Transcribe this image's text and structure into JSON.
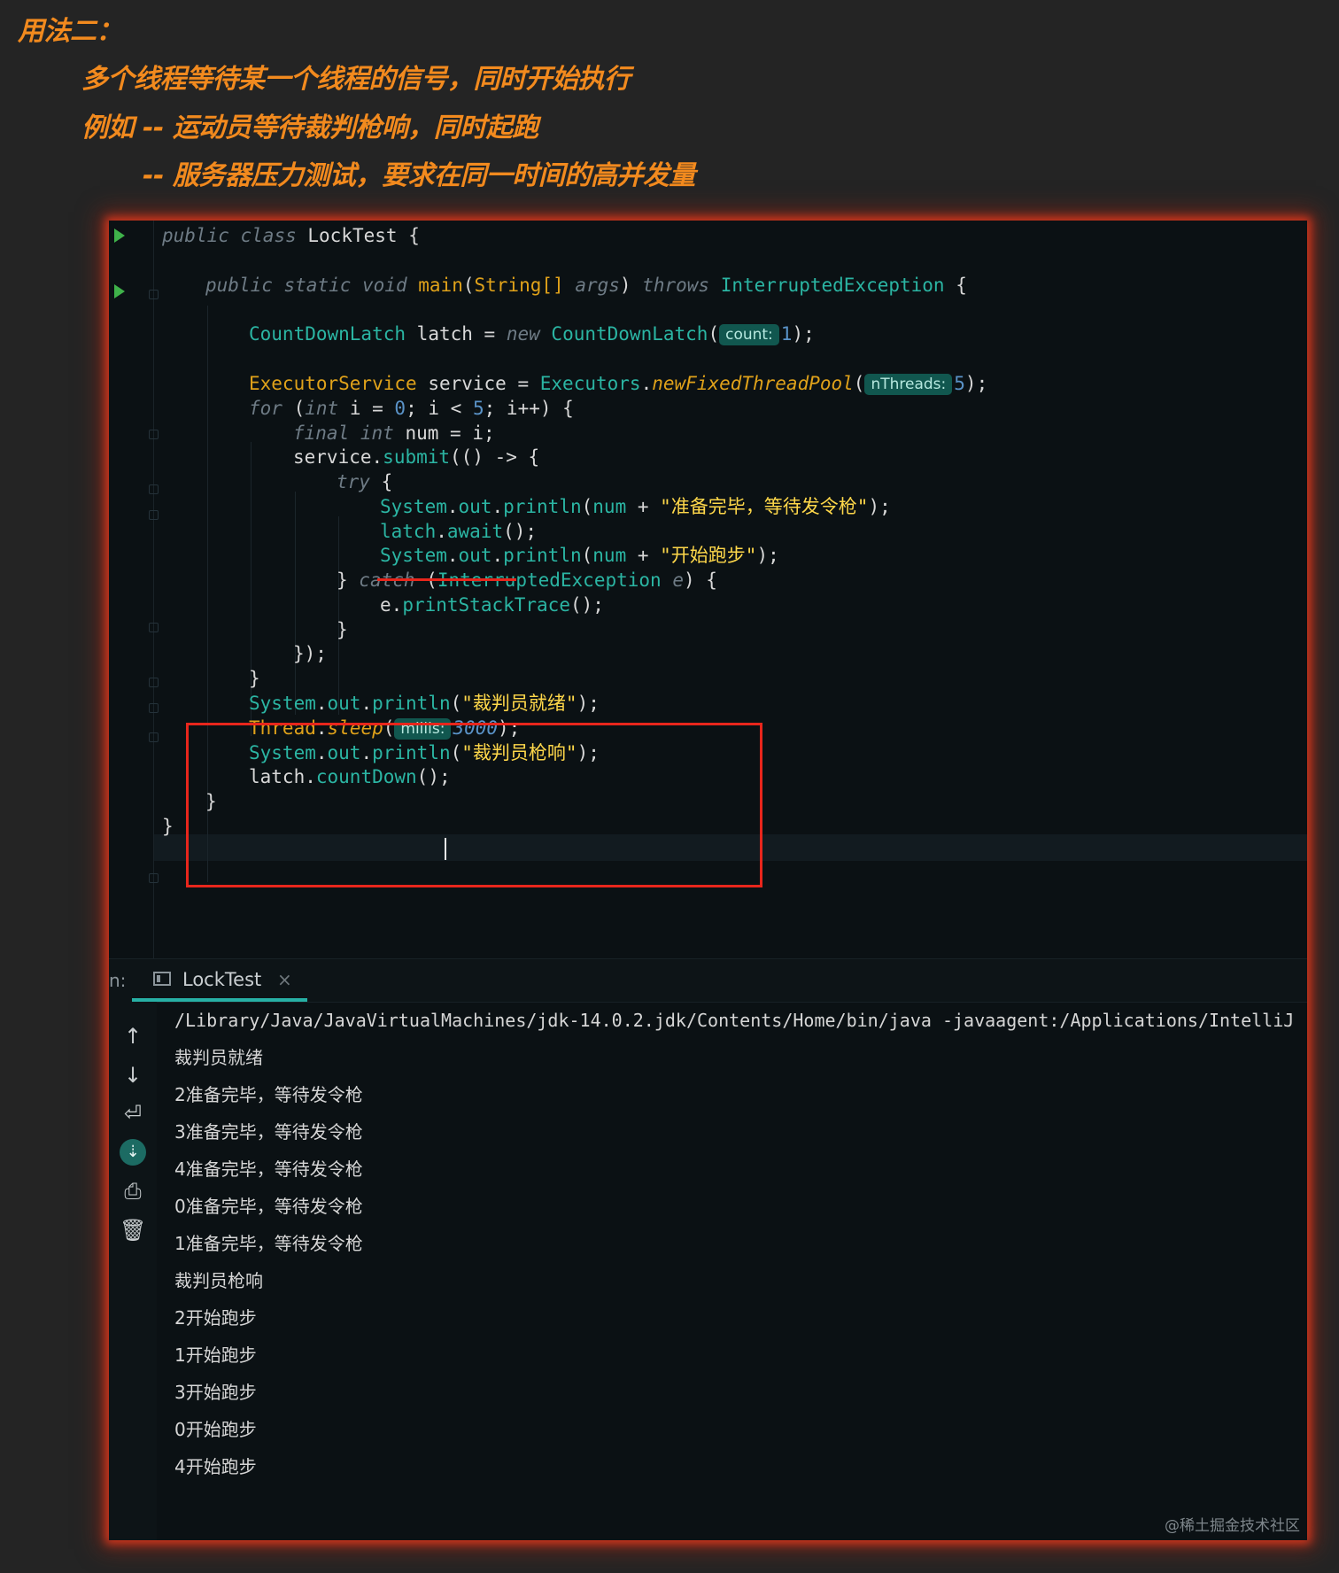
{
  "headings": [
    "用法二：",
    "多个线程等待某一个线程的信号，同时开始执行",
    "例如 -- 运动员等待裁判枪响，同时起跑",
    "-- 服务器压力测试，要求在同一时间的高并发量"
  ],
  "code": {
    "public": "public",
    "class": "class",
    "static": "static",
    "void": "void",
    "throws": "throws",
    "new": "new",
    "for": "for",
    "int": "int",
    "final": "final",
    "try": "try",
    "catch": "catch",
    "class_name": "LockTest",
    "main": "main",
    "string_array": "String[]",
    "args": "args",
    "interrupted_exception": "InterruptedException",
    "count_down_latch": "CountDownLatch",
    "latch": "latch",
    "count_hint": "count:",
    "one": "1",
    "executor_service": "ExecutorService",
    "service": "service",
    "executors": "Executors",
    "new_fixed_thread_pool": "newFixedThreadPool",
    "nthreads_hint": "nThreads:",
    "five": "5",
    "i": "i",
    "zero": "0",
    "num": "num",
    "submit": "submit",
    "system": "System",
    "out": "out",
    "println": "println",
    "str_ready": "\"准备完毕，等待发令枪\"",
    "await": "await",
    "str_start": "\"开始跑步\"",
    "e": "e",
    "print_stack_trace": "printStackTrace",
    "str_referee_ready": "\"裁判员就绪\"",
    "thread": "Thread",
    "sleep": "sleep",
    "millis_hint": "millis:",
    "three_thousand": "3000",
    "str_referee_shot": "\"裁判员枪响\"",
    "count_down": "countDown"
  },
  "run_panel": {
    "label": "n:",
    "tab_label": "LockTest",
    "tab_close": "×"
  },
  "console": {
    "command": "/Library/Java/JavaVirtualMachines/jdk-14.0.2.jdk/Contents/Home/bin/java -javaagent:/Applications/IntelliJ",
    "lines": [
      "裁判员就绪",
      "2准备完毕，等待发令枪",
      "3准备完毕，等待发令枪",
      "4准备完毕，等待发令枪",
      "0准备完毕，等待发令枪",
      "1准备完毕，等待发令枪",
      "裁判员枪响",
      "2开始跑步",
      "1开始跑步",
      "3开始跑步",
      "0开始跑步",
      "4开始跑步"
    ]
  },
  "icons": [
    "run-icon",
    "arrow-up-icon",
    "arrow-down-icon",
    "soft-wrap-icon",
    "scroll-to-end-icon",
    "print-icon",
    "trash-icon",
    "console-icon",
    "close-icon"
  ],
  "colors": {
    "heading": "#f28a1e",
    "highlight_box": "#e8261c",
    "tab_accent": "#27b0a5"
  },
  "watermark": "@稀土掘金技术社区"
}
